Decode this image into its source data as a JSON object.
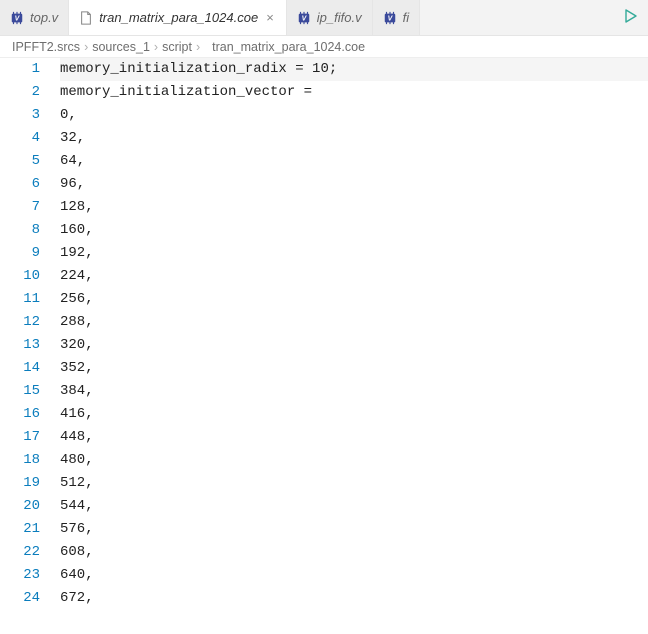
{
  "tabs": [
    {
      "label": "top.v",
      "icon": "verilog",
      "active": false
    },
    {
      "label": "tran_matrix_para_1024.coe",
      "icon": "file",
      "active": true,
      "closeable": true
    },
    {
      "label": "ip_fifo.v",
      "icon": "verilog",
      "active": false
    },
    {
      "label": "fi",
      "icon": "verilog",
      "active": false,
      "partial": true
    }
  ],
  "close_glyph": "×",
  "breadcrumbs": {
    "segments": [
      "IPFFT2.srcs",
      "sources_1",
      "script"
    ],
    "file": "tran_matrix_para_1024.coe",
    "sep": "›"
  },
  "editor": {
    "lines": [
      "memory_initialization_radix = 10;",
      "memory_initialization_vector =",
      "0,",
      "32,",
      "64,",
      "96,",
      "128,",
      "160,",
      "192,",
      "224,",
      "256,",
      "288,",
      "320,",
      "352,",
      "384,",
      "416,",
      "448,",
      "480,",
      "512,",
      "544,",
      "576,",
      "608,",
      "640,",
      "672,"
    ],
    "highlight_first": true
  }
}
